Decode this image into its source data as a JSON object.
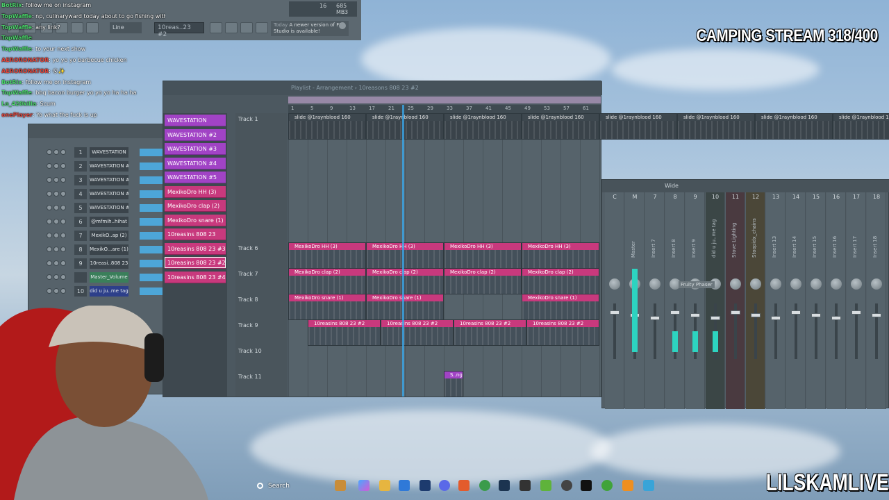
{
  "stream": {
    "title": "CAMPING STREAM 318/400",
    "brand": "LILSKAMLIVE"
  },
  "toolbar": {
    "snap": "Line",
    "pattern": "10reas..23 #2",
    "cpu": "16",
    "ram": "685 MB",
    "voices": "3",
    "news_today": "Today",
    "news_text": "A newer version of FL Studio is available!"
  },
  "chat": [
    {
      "user": "BotRix",
      "color": "#4cd36b",
      "text": ": follow me on instagram"
    },
    {
      "user": "TopWaffle",
      "color": "#4cd36b",
      "text": ": np, culinaryward today about to go fishing with the homie. Hope you have a good Saturday"
    },
    {
      "user": "TopWaffle",
      "color": "#4cd36b",
      "text": ": any link?"
    },
    {
      "user": "TopWaffle",
      "color": "#4cd36b",
      "text": ""
    },
    {
      "user": "TopWaffle",
      "color": "#4cd36b",
      "text": ": to your next show"
    },
    {
      "user": "AERORONATOR",
      "color": "#e0453b",
      "text": ": yo yo yo barbecue chicken"
    },
    {
      "user": "AERORONATOR",
      "color": "#e0453b",
      "text": ": 😮✨"
    },
    {
      "user": "BotRix",
      "color": "#4cd36b",
      "text": ": follow me on instagram"
    },
    {
      "user": "TopWaffle",
      "color": "#4cd36b",
      "text": ": bbq bacon burger yo yo yo ha ha ha"
    },
    {
      "user": "Lo_420killa",
      "color": "#4cd36b",
      "text": ": Scum"
    },
    {
      "user": "onePlayer",
      "color": "#e0453b",
      "text": ": Yo what the fuck is up"
    }
  ],
  "channel_rack": {
    "channels": [
      {
        "num": "1",
        "name": "WAVESTATION",
        "style": "dark"
      },
      {
        "num": "2",
        "name": "WAVESTATION #2",
        "style": "dark"
      },
      {
        "num": "3",
        "name": "WAVESTATION #3",
        "style": "dark"
      },
      {
        "num": "4",
        "name": "WAVESTATION #4",
        "style": "dark"
      },
      {
        "num": "5",
        "name": "WAVESTATION #5",
        "style": "dark"
      },
      {
        "num": "6",
        "name": "@mfmih..hihat",
        "style": "dark"
      },
      {
        "num": "7",
        "name": "MexikO..ap (2)",
        "style": "dark"
      },
      {
        "num": "8",
        "name": "MexikO...are (1)",
        "style": "dark"
      },
      {
        "num": "9",
        "name": "10reasi..808 23",
        "style": "dark"
      },
      {
        "num": "",
        "name": "Master_Volume",
        "style": "green"
      },
      {
        "num": "10",
        "name": "did u ju..me tag",
        "style": "blue"
      }
    ]
  },
  "playlist": {
    "title": "Playlist - Arrangement › 10reasons 808 23 #2",
    "patterns": [
      {
        "name": "WAVESTATION",
        "color": "purple"
      },
      {
        "name": "WAVESTATION #2",
        "color": "purple"
      },
      {
        "name": "WAVESTATION #3",
        "color": "purple"
      },
      {
        "name": "WAVESTATION #4",
        "color": "purple"
      },
      {
        "name": "WAVESTATION #5",
        "color": "purple"
      },
      {
        "name": "MexikoDro HH (3)",
        "color": "pink"
      },
      {
        "name": "MexikoDro clap (2)",
        "color": "pink"
      },
      {
        "name": "MexikoDro snare (1)",
        "color": "pink"
      },
      {
        "name": "10reasins 808 23",
        "color": "pink"
      },
      {
        "name": "10reasins 808 23 #3",
        "color": "pink"
      },
      {
        "name": "10reasins 808 23 #2",
        "color": "pink",
        "selected": true
      },
      {
        "name": "10reasins 808 23 #4",
        "color": "pink"
      }
    ],
    "tracks": [
      "Track 1",
      "Track 6",
      "Track 7",
      "Track 8",
      "Track 9",
      "Track 10",
      "Track 11"
    ],
    "ruler": [
      "1",
      "5",
      "9",
      "13",
      "17",
      "21",
      "25",
      "29",
      "33",
      "37",
      "41",
      "45",
      "49",
      "53",
      "57",
      "61"
    ],
    "clip_labels": {
      "audio": "slide @1raynblood 160",
      "hh": "MexikoDro HH (3)",
      "clap": "MexikoDro clap (2)",
      "snare": "MexikoDro snare (1)",
      "bass": "10reasins 808 23 #2",
      "small": "S..ng"
    }
  },
  "mixer": {
    "preset": "Wide",
    "strips": [
      {
        "num": "C",
        "name": ""
      },
      {
        "num": "M",
        "name": "Master"
      },
      {
        "num": "7",
        "name": "Insert 7"
      },
      {
        "num": "8",
        "name": "Insert 8"
      },
      {
        "num": "9",
        "name": "Insert 9"
      },
      {
        "num": "10",
        "name": "did u ju..me tag"
      },
      {
        "num": "11",
        "name": "Stove Lighting"
      },
      {
        "num": "12",
        "name": "Stoopidx_chains"
      },
      {
        "num": "13",
        "name": "Insert 13"
      },
      {
        "num": "14",
        "name": "Insert 14"
      },
      {
        "num": "15",
        "name": "Insert 15"
      },
      {
        "num": "16",
        "name": "Insert 16"
      },
      {
        "num": "17",
        "name": "Insert 17"
      },
      {
        "num": "18",
        "name": "Insert 18"
      }
    ],
    "effect_label": "Fruity Phaser"
  },
  "taskbar": {
    "search": "Search"
  }
}
